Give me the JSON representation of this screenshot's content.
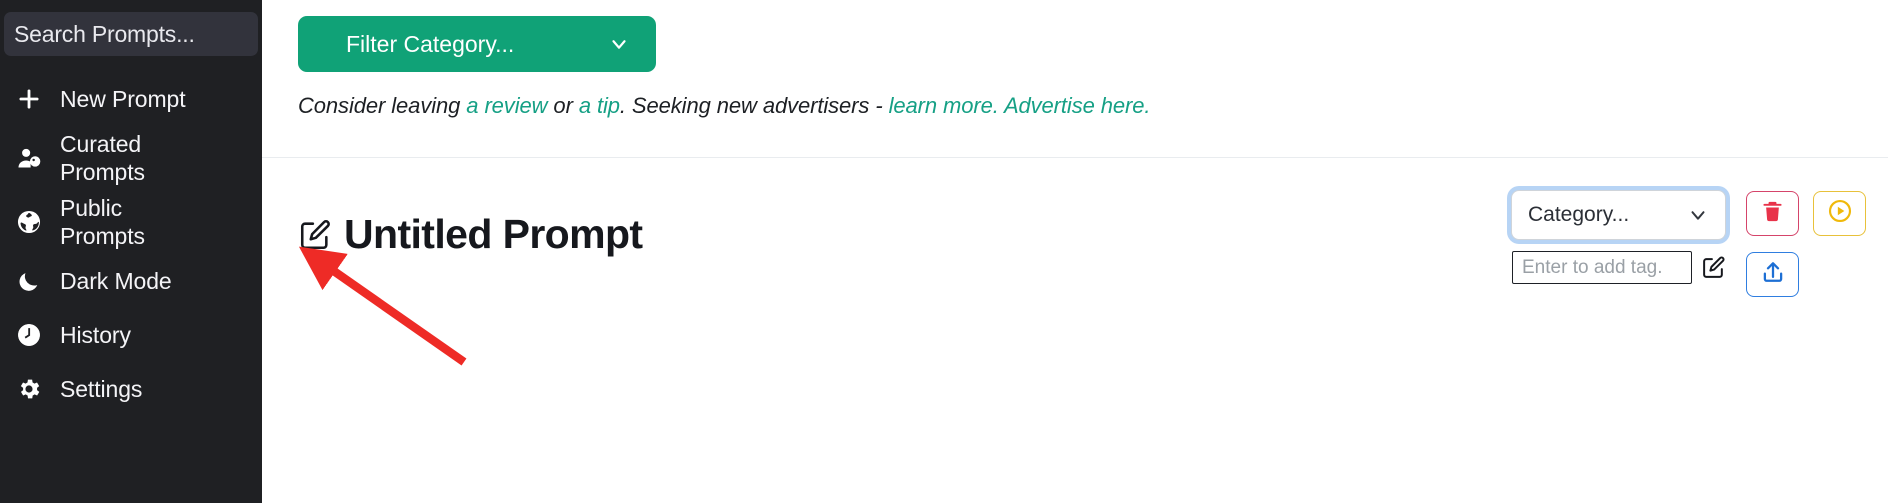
{
  "sidebar": {
    "search": {
      "placeholder": "Search Prompts...",
      "value": ""
    },
    "items": [
      {
        "label": "New Prompt",
        "icon": "plus-icon"
      },
      {
        "label": "Curated\nPrompts",
        "icon": "user-tag-icon"
      },
      {
        "label": "Public Prompts",
        "icon": "globe-icon"
      },
      {
        "label": "Dark Mode",
        "icon": "moon-icon"
      },
      {
        "label": "History",
        "icon": "clock-icon"
      },
      {
        "label": "Settings",
        "icon": "gear-icon"
      }
    ]
  },
  "toolbar": {
    "filter_category_label": "Filter Category...",
    "filter_chevron_icon": "chevron-down-icon"
  },
  "ad": {
    "part1": "Consider leaving ",
    "link_review": "a review",
    "part2": " or ",
    "link_tip": "a tip",
    "part3": ". Seeking new advertisers - ",
    "link_learn_more": "learn more.",
    "spacer": "  ",
    "link_advertise": "Advertise here."
  },
  "prompt": {
    "title": "Untitled Prompt",
    "title_edit_icon": "edit-pencil-icon",
    "category": {
      "value": "Category...",
      "chevron_icon": "chevron-down-icon"
    },
    "tag": {
      "placeholder": "Enter to add tag.",
      "value": "",
      "edit_icon": "edit-pencil-icon"
    },
    "actions": [
      {
        "name": "delete-button",
        "icon": "trash-icon",
        "color": "#e8334a"
      },
      {
        "name": "run-button",
        "icon": "play-circle-icon",
        "color": "#f0b90b"
      },
      {
        "name": "upload-button",
        "icon": "upload-icon",
        "color": "#1d6fd4"
      }
    ]
  },
  "annotation": {
    "arrow_color": "#ee2b26"
  },
  "colors": {
    "sidebar_bg": "#1f2023",
    "accent_green": "#10a277",
    "link_green": "#16a085",
    "focus_ring": "#b7d4f5"
  }
}
